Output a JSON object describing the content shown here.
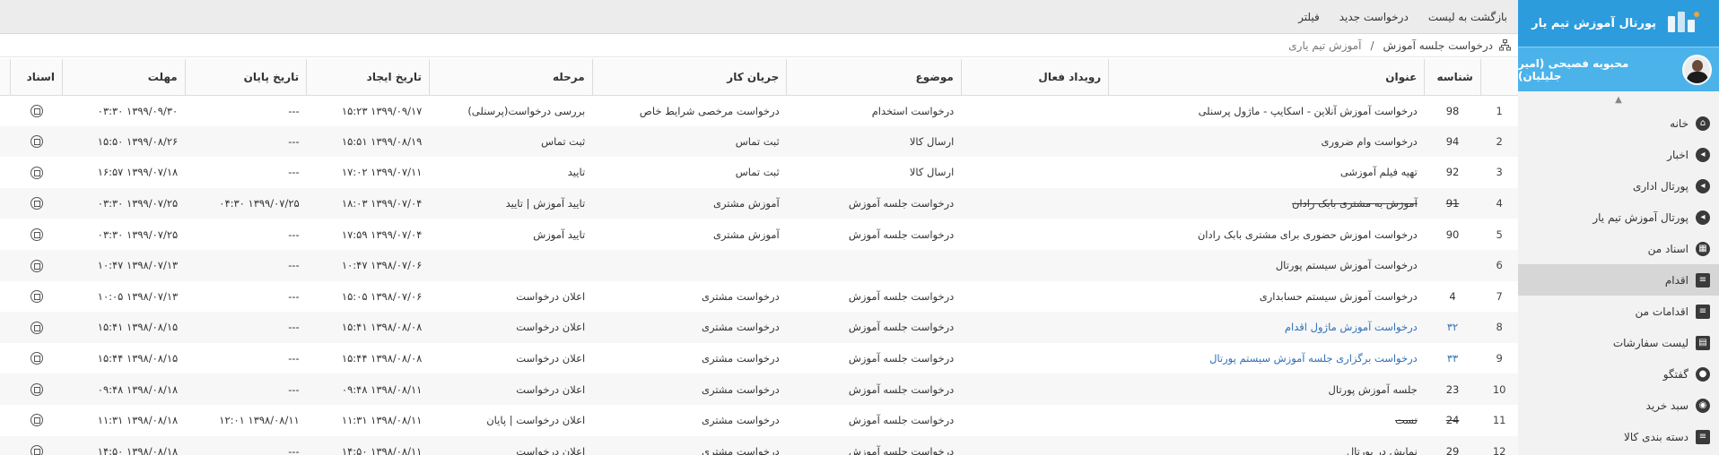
{
  "sidebar": {
    "brand_title": "پورتال آموزش تیم یار",
    "user_name": "محبوبه فصیحی (امیر جلیلیان)",
    "items": [
      {
        "label": "خانه",
        "icon": "home-icon"
      },
      {
        "label": "اخبار",
        "icon": "megaphone-icon"
      },
      {
        "label": "پورتال اداری",
        "icon": "megaphone-icon"
      },
      {
        "label": "پورتال آموزش تیم یار",
        "icon": "megaphone-icon"
      },
      {
        "label": "اسناد من",
        "icon": "documents-icon"
      },
      {
        "label": "اقدام",
        "icon": "list-icon"
      },
      {
        "label": "اقدامات من",
        "icon": "list-icon"
      },
      {
        "label": "لیست سفارشات",
        "icon": "clipboard-icon"
      },
      {
        "label": "گفتگو",
        "icon": "chat-icon"
      },
      {
        "label": "سبد خرید",
        "icon": "cart-icon"
      },
      {
        "label": "دسته بندی کالا",
        "icon": "list-icon"
      }
    ]
  },
  "toolbar": {
    "back": "بازگشت به لیست",
    "new_request": "درخواست جدید",
    "filter": "فیلتر"
  },
  "breadcrumb": {
    "parent": "درخواست جلسه آموزش",
    "separator": "/",
    "current": "آموزش تیم یاری"
  },
  "table": {
    "headers": {
      "id": "شناسه",
      "title": "عنوان",
      "active_event": "رویداد فعال",
      "subject": "موضوع",
      "workflow": "جریان کار",
      "stage": "مرحله",
      "created": "تاریخ ایجاد",
      "end": "تاریخ پایان",
      "deadline": "مهلت",
      "docs": "اسناد"
    },
    "rows": [
      {
        "n": "1",
        "id": "98",
        "title": "درخواست آموزش آنلاین - اسکایپ - ماژول پرسنلی",
        "event": "",
        "subject": "درخواست استخدام",
        "workflow": "درخواست مرخصی شرایط خاص",
        "stage": "بررسی درخواست(پرسنلی)",
        "created": "۱۳۹۹/۰۹/۱۷ ۱۵:۲۳",
        "end": "---",
        "deadline": "۱۳۹۹/۰۹/۳۰ ۰۳:۳۰"
      },
      {
        "n": "2",
        "id": "94",
        "title": "درخواست وام ضروری",
        "event": "",
        "subject": "ارسال کالا",
        "workflow": "ثبت تماس",
        "stage": "ثبت تماس",
        "created": "۱۳۹۹/۰۸/۱۹ ۱۵:۵۱",
        "end": "---",
        "deadline": "۱۳۹۹/۰۸/۲۶ ۱۵:۵۰"
      },
      {
        "n": "3",
        "id": "92",
        "title": "تهیه فیلم آموزشی",
        "event": "",
        "subject": "ارسال کالا",
        "workflow": "ثبت تماس",
        "stage": "تایید",
        "created": "۱۳۹۹/۰۷/۱۱ ۱۷:۰۲",
        "end": "---",
        "deadline": "۱۳۹۹/۰۷/۱۸ ۱۶:۵۷"
      },
      {
        "n": "4",
        "id": "91",
        "title": "آموزش به مشتری بابک رادان",
        "event": "",
        "subject": "درخواست جلسه آموزش",
        "workflow": "آموزش مشتری",
        "stage": "تایید آموزش | تایید",
        "created": "۱۳۹۹/۰۷/۰۴ ۱۸:۰۳",
        "end": "۱۳۹۹/۰۷/۲۵ ۰۴:۳۰",
        "deadline": "۱۳۹۹/۰۷/۲۵ ۰۳:۳۰",
        "strike": true
      },
      {
        "n": "5",
        "id": "90",
        "title": "درخواست اموزش حضوری برای مشتری بابک رادان",
        "event": "",
        "subject": "درخواست جلسه آموزش",
        "workflow": "آموزش مشتری",
        "stage": "تایید آموزش",
        "created": "۱۳۹۹/۰۷/۰۴ ۱۷:۵۹",
        "end": "---",
        "deadline": "۱۳۹۹/۰۷/۲۵ ۰۳:۳۰"
      },
      {
        "n": "6",
        "id": "",
        "title": "درخواست آموزش سیستم پورتال",
        "event": "",
        "subject": "",
        "workflow": "",
        "stage": "",
        "created": "۱۳۹۸/۰۷/۰۶ ۱۰:۴۷",
        "end": "---",
        "deadline": "۱۳۹۸/۰۷/۱۳ ۱۰:۴۷"
      },
      {
        "n": "7",
        "id": "4",
        "title": "درخواست آموزش سیستم حسابداری",
        "event": "",
        "subject": "درخواست جلسه آموزش",
        "workflow": "درخواست مشتری",
        "stage": "اعلان درخواست",
        "created": "۱۳۹۸/۰۷/۰۶ ۱۵:۰۵",
        "end": "---",
        "deadline": "۱۳۹۸/۰۷/۱۳ ۱۰:۰۵"
      },
      {
        "n": "8",
        "id": "۳۲",
        "title": "درخواست آموزش ماژول اقدام",
        "event": "",
        "subject": "درخواست جلسه آموزش",
        "workflow": "درخواست مشتری",
        "stage": "اعلان درخواست",
        "created": "۱۳۹۸/۰۸/۰۸ ۱۵:۴۱",
        "end": "---",
        "deadline": "۱۳۹۸/۰۸/۱۵ ۱۵:۴۱",
        "link": true
      },
      {
        "n": "9",
        "id": "۳۳",
        "title": "درخواست برگزاری جلسه آموزش سیستم پورتال",
        "event": "",
        "subject": "درخواست جلسه آموزش",
        "workflow": "درخواست مشتری",
        "stage": "اعلان درخواست",
        "created": "۱۳۹۸/۰۸/۰۸ ۱۵:۴۴",
        "end": "---",
        "deadline": "۱۳۹۸/۰۸/۱۵ ۱۵:۴۴",
        "link": true
      },
      {
        "n": "10",
        "id": "23",
        "title": "جلسه آموزش پورتال",
        "event": "",
        "subject": "درخواست جلسه آموزش",
        "workflow": "درخواست مشتری",
        "stage": "اعلان درخواست",
        "created": "۱۳۹۸/۰۸/۱۱ ۰۹:۴۸",
        "end": "---",
        "deadline": "۱۳۹۸/۰۸/۱۸ ۰۹:۴۸"
      },
      {
        "n": "11",
        "id": "24",
        "title": "تست",
        "event": "",
        "subject": "درخواست جلسه آموزش",
        "workflow": "درخواست مشتری",
        "stage": "اعلان درخواست | پایان",
        "created": "۱۳۹۸/۰۸/۱۱ ۱۱:۳۱",
        "end": "۱۳۹۸/۰۸/۱۱ ۱۲:۰۱",
        "deadline": "۱۳۹۸/۰۸/۱۸ ۱۱:۳۱",
        "strike": true
      },
      {
        "n": "12",
        "id": "29",
        "title": "نمایش در پورتال",
        "event": "",
        "subject": "درخواست جلسه آموزش",
        "workflow": "درخواست مشتری",
        "stage": "اعلان درخواست",
        "created": "۱۳۹۸/۰۸/۱۱ ۱۴:۵۰",
        "end": "---",
        "deadline": "۱۳۹۸/۰۸/۱۸ ۱۴:۵۰"
      }
    ]
  }
}
